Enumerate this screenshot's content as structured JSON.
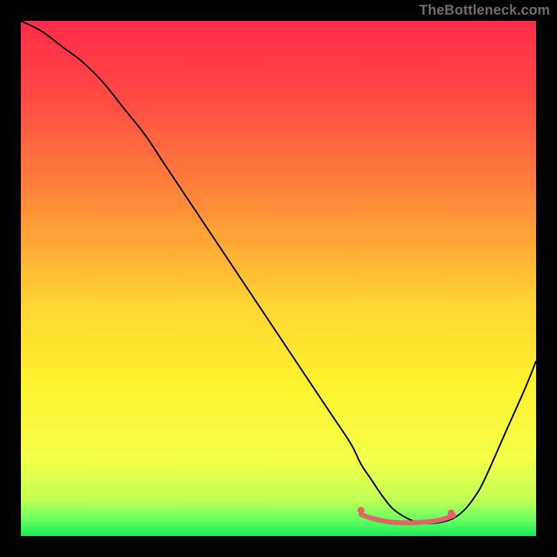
{
  "watermark": "TheBottleneck.com",
  "chart_data": {
    "type": "line",
    "title": "",
    "xlabel": "",
    "ylabel": "",
    "xlim": [
      0,
      100
    ],
    "ylim": [
      0,
      100
    ],
    "gradient_stops": [
      {
        "offset": 0,
        "color": "#ff2b4a"
      },
      {
        "offset": 15,
        "color": "#ff4a44"
      },
      {
        "offset": 35,
        "color": "#ff8a3a"
      },
      {
        "offset": 55,
        "color": "#ffd433"
      },
      {
        "offset": 70,
        "color": "#fff22e"
      },
      {
        "offset": 85,
        "color": "#f4ff4a"
      },
      {
        "offset": 93,
        "color": "#c1ff55"
      },
      {
        "offset": 97,
        "color": "#63ff60"
      },
      {
        "offset": 100,
        "color": "#17e855"
      }
    ],
    "series": [
      {
        "name": "bottleneck-curve",
        "stroke": "#000000",
        "x": [
          0,
          4,
          8,
          12,
          16,
          20,
          24,
          28,
          32,
          36,
          40,
          44,
          48,
          52,
          56,
          60,
          64,
          66,
          68,
          70,
          72,
          74,
          76,
          78,
          80,
          82,
          84,
          86,
          88,
          90,
          94,
          98,
          100
        ],
        "values": [
          100,
          98,
          95,
          92,
          88,
          83,
          78,
          72,
          66,
          60,
          54,
          48,
          42,
          36,
          30,
          24,
          18,
          14,
          11,
          8,
          5.5,
          4,
          3,
          2.5,
          2.5,
          2.8,
          3.5,
          5,
          7.5,
          11,
          20,
          29,
          34
        ]
      },
      {
        "name": "trough-highlight",
        "stroke": "#de6568",
        "stroke_width": 7,
        "cap": "round",
        "x": [
          66,
          68,
          70,
          72,
          74,
          76,
          78,
          80,
          82,
          84
        ],
        "values": [
          4.2,
          3.5,
          3.0,
          2.7,
          2.6,
          2.6,
          2.7,
          2.9,
          3.3,
          4.0
        ]
      }
    ],
    "trough_dots": {
      "color": "#de6568",
      "radius": 5,
      "points": [
        {
          "x": 66,
          "y": 5.0
        },
        {
          "x": 83.5,
          "y": 4.5
        }
      ]
    }
  }
}
